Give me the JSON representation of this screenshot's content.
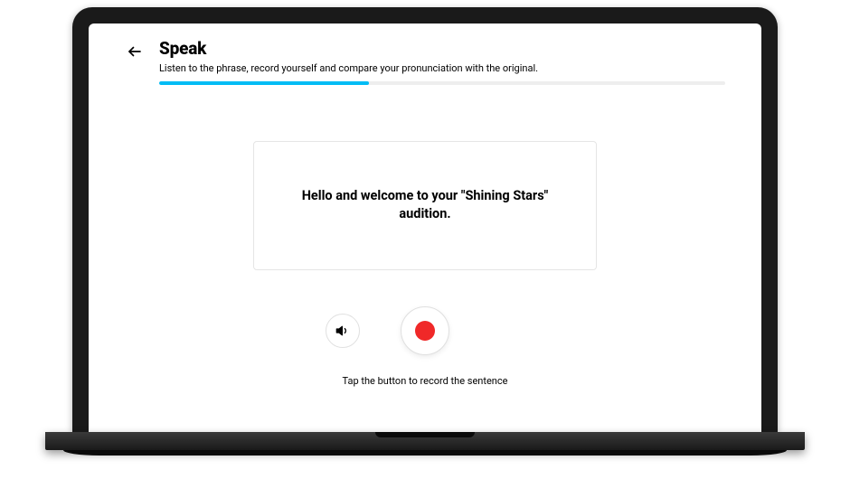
{
  "header": {
    "title": "Speak",
    "subtitle": "Listen to the phrase, record yourself and compare your pronunciation with the original."
  },
  "progress": {
    "percent": 37
  },
  "phrase": {
    "text": "Hello and welcome to your \"Shining Stars\" audition."
  },
  "hint": "Tap the button to record the sentence",
  "colors": {
    "progress": "#00bcf5",
    "record": "#f02828"
  }
}
